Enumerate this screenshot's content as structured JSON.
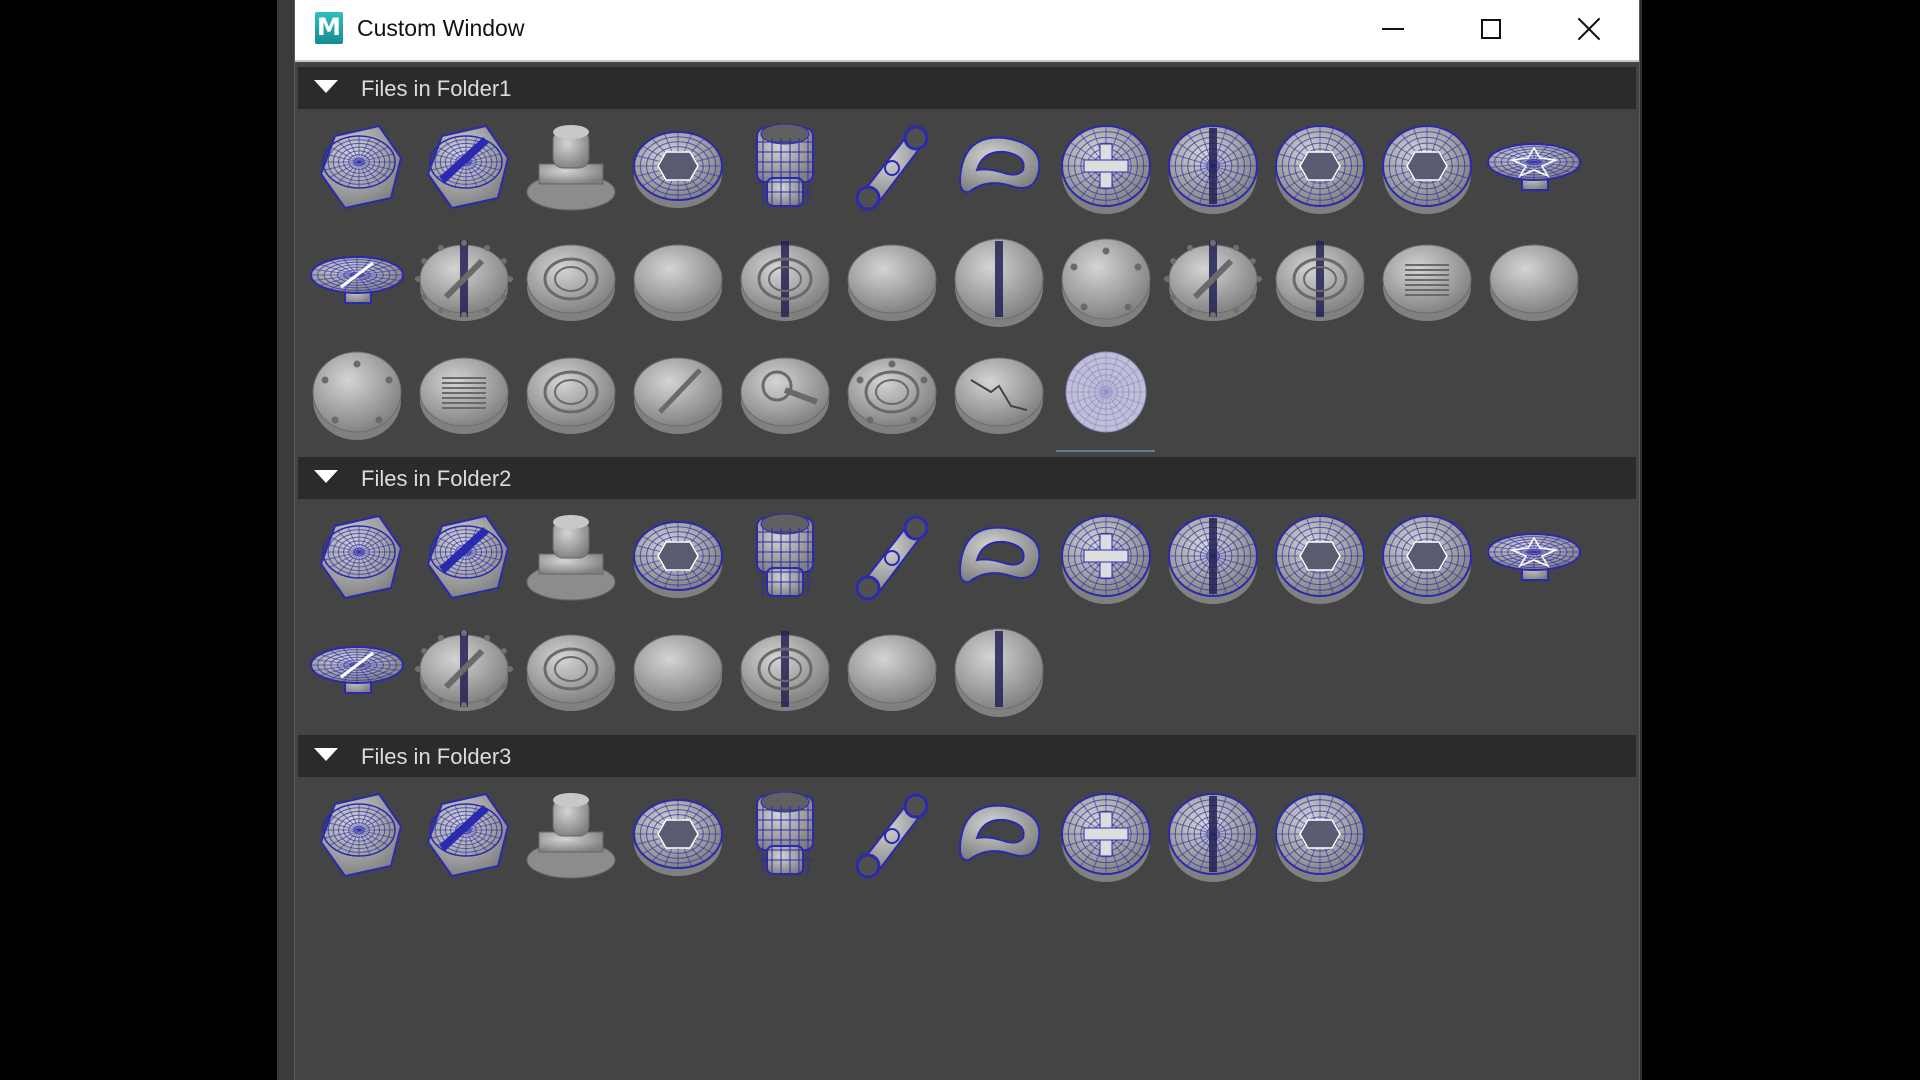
{
  "window": {
    "title": "Custom Window",
    "app_icon_letter": "M",
    "controls": [
      "minimize",
      "maximize",
      "close"
    ]
  },
  "sections": [
    {
      "label": "Files in Folder1",
      "items": [
        {
          "icon": "hex-bolt-wire-icon"
        },
        {
          "icon": "slotted-hex-bolt-wire-icon"
        },
        {
          "icon": "cap-nut-icon"
        },
        {
          "icon": "hex-socket-cap-wire-icon"
        },
        {
          "icon": "socket-wire-icon"
        },
        {
          "icon": "hinge-link-wire-icon"
        },
        {
          "icon": "ring-loop-wire-icon"
        },
        {
          "icon": "phillips-dome-wire-icon"
        },
        {
          "icon": "slotted-dome-wire-icon"
        },
        {
          "icon": "hex-dome-wire-icon"
        },
        {
          "icon": "hex-socket-dome-wire-icon"
        },
        {
          "icon": "star-flat-screw-wire-icon"
        },
        {
          "icon": "slotted-flat-screw-wire-icon"
        },
        {
          "icon": "knurled-slotted-cap-icon"
        },
        {
          "icon": "bolted-ring-cap-icon"
        },
        {
          "icon": "plain-disc-cap-icon"
        },
        {
          "icon": "ringed-slot-cap-icon"
        },
        {
          "icon": "smooth-disc-cap-icon"
        },
        {
          "icon": "slot-dome-cap-icon"
        },
        {
          "icon": "pinned-dome-cap-icon"
        },
        {
          "icon": "gear-slotted-cap-icon"
        },
        {
          "icon": "ring-slot-cap-icon"
        },
        {
          "icon": "vented-cap-icon"
        },
        {
          "icon": "flat-plug-cap-icon"
        },
        {
          "icon": "riveted-dome-cap-icon"
        },
        {
          "icon": "ribbed-flat-cap-icon"
        },
        {
          "icon": "ornate-ring-cap-icon"
        },
        {
          "icon": "grooved-cap-icon"
        },
        {
          "icon": "keyhole-cap-icon"
        },
        {
          "icon": "bolted-disc-cap-icon"
        },
        {
          "icon": "cracked-cap-icon"
        },
        {
          "icon": "wire-sphere-icon",
          "selected": true
        }
      ]
    },
    {
      "label": "Files in Folder2",
      "items": [
        {
          "icon": "hex-bolt-wire-icon"
        },
        {
          "icon": "slotted-hex-bolt-wire-icon"
        },
        {
          "icon": "cap-nut-icon"
        },
        {
          "icon": "hex-socket-cap-wire-icon"
        },
        {
          "icon": "socket-wire-icon"
        },
        {
          "icon": "hinge-link-wire-icon"
        },
        {
          "icon": "ring-loop-wire-icon"
        },
        {
          "icon": "phillips-dome-wire-icon"
        },
        {
          "icon": "slotted-dome-wire-icon"
        },
        {
          "icon": "hex-dome-wire-icon"
        },
        {
          "icon": "hex-socket-dome-wire-icon"
        },
        {
          "icon": "star-flat-screw-wire-icon"
        },
        {
          "icon": "slotted-flat-screw-wire-icon"
        },
        {
          "icon": "knurled-slotted-cap-icon"
        },
        {
          "icon": "bolted-ring-cap-icon"
        },
        {
          "icon": "plain-disc-cap-icon"
        },
        {
          "icon": "ringed-slot-cap-icon"
        },
        {
          "icon": "smooth-disc-cap-icon"
        },
        {
          "icon": "slot-dome-cap-icon"
        }
      ]
    },
    {
      "label": "Files in Folder3",
      "items": [
        {
          "icon": "hex-bolt-wire-icon"
        },
        {
          "icon": "slotted-hex-bolt-wire-icon"
        },
        {
          "icon": "cap-nut-icon"
        },
        {
          "icon": "hex-socket-cap-wire-icon"
        },
        {
          "icon": "socket-wire-icon"
        },
        {
          "icon": "hinge-link-wire-icon"
        },
        {
          "icon": "ring-loop-wire-icon"
        },
        {
          "icon": "phillips-dome-wire-icon"
        },
        {
          "icon": "slotted-dome-wire-icon"
        },
        {
          "icon": "hex-dome-wire-icon"
        }
      ]
    }
  ],
  "colors": {
    "panel_bg": "#444444",
    "header_bg": "#2b2b2b",
    "model_gray": "#a9a9a9",
    "wire_blue": "#2a2ab0"
  }
}
